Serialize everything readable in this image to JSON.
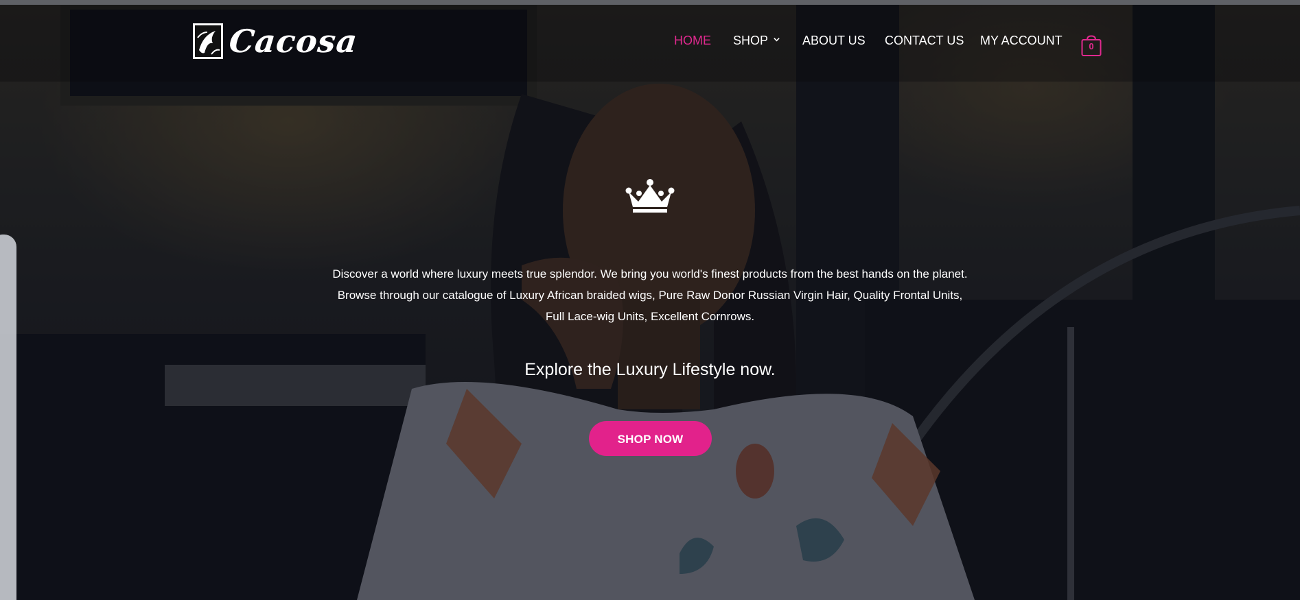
{
  "brand": {
    "name": "Cacosa",
    "logo_icon": "brand-logo-mark"
  },
  "nav": {
    "items": [
      {
        "label": "HOME",
        "active": true
      },
      {
        "label": "SHOP",
        "has_dropdown": true
      },
      {
        "label": "ABOUT US"
      },
      {
        "label": "CONTACT US"
      },
      {
        "label": "MY ACCOUNT"
      }
    ],
    "cart": {
      "icon": "shopping-bag-icon",
      "count": "0"
    }
  },
  "hero": {
    "icon": "crown-icon",
    "intro_lines": [
      "Discover a world where luxury meets true splendor. We bring you world's finest products from the best hands on the planet.",
      "Browse through our catalogue of Luxury African braided wigs, Pure Raw Donor Russian Virgin Hair, Quality Frontal Units,",
      "Full Lace-wig Units, Excellent Cornrows."
    ],
    "tagline": "Explore the Luxury Lifestyle now.",
    "cta_label": "SHOP NOW"
  },
  "colors": {
    "accent": "#e2228b",
    "nav_active": "#e0298f",
    "text": "#ffffff"
  }
}
